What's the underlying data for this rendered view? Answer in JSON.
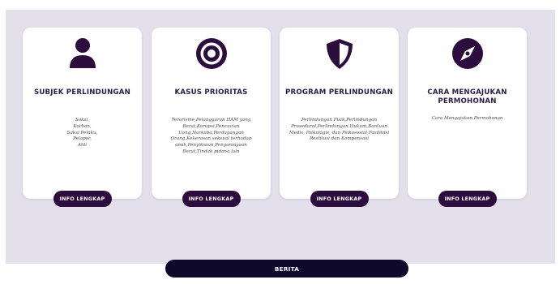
{
  "colors": {
    "band_bg": "#e3e0ec",
    "card_bg": "#ffffff",
    "accent_dark": "#2c0d3e",
    "news_bar": "#0f0a2b",
    "title_text": "#2b1b4a"
  },
  "cards": [
    {
      "icon": "user-icon",
      "title": "SUBJEK PERLINDUNGAN",
      "description": "Saksi,\nKorban,\nSaksi Pelaku,\nPelapor,\nAhli",
      "button_label": "INFO LENGKAP"
    },
    {
      "icon": "target-icon",
      "title": "KASUS PRIORITAS",
      "description": "Terorisme,Pelanggaran HAM yang Berat,Korupsi,Pencucian Uang,Narkoba,Perdagangan Orang,Kekerasan seksual terhadap anak,Penyiksaan,Penganiayaan Berat,Tindak pidana lain",
      "button_label": "INFO LENGKAP"
    },
    {
      "icon": "shield-icon",
      "title": "PROGRAM PERLINDUNGAN",
      "description": "Perlindungan Fisik,Perlindungan Prosedural,Perlindungan Hukum,Bantuan Medis, Psikologis, dan Psikososial,Fasilitasi Restitusi dan Kompensasi",
      "button_label": "INFO LENGKAP"
    },
    {
      "icon": "compass-icon",
      "title": "CARA MENGAJUKAN PERMOHONAN",
      "description": "Cara Mengajukan Permohonan",
      "button_label": "INFO LENGKAP"
    }
  ],
  "news_button": {
    "label": "BERITA"
  }
}
